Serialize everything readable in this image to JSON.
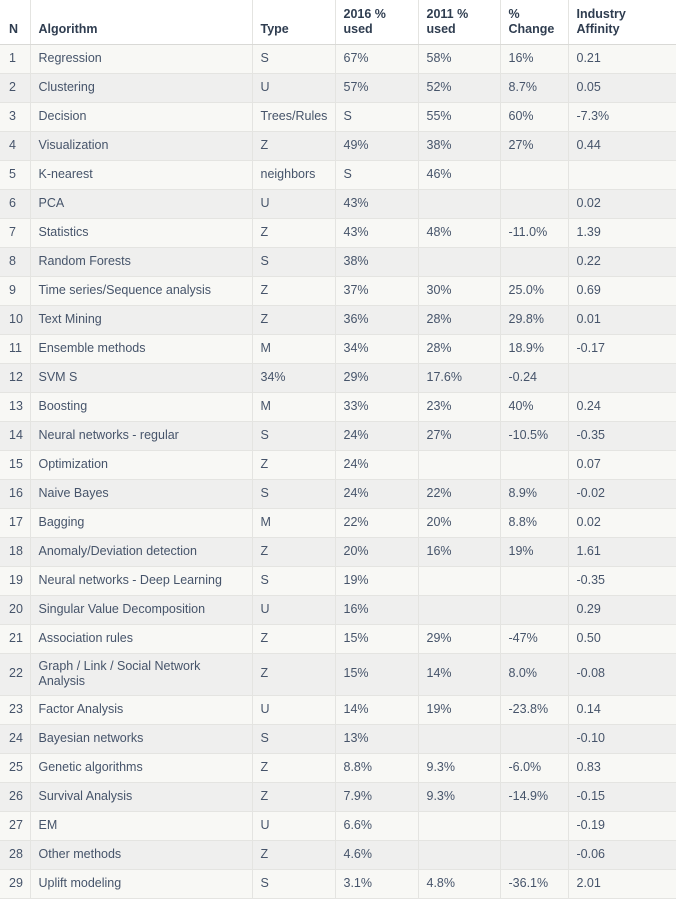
{
  "table": {
    "columns": [
      {
        "key": "n",
        "label": "N"
      },
      {
        "key": "alg",
        "label": "Algorithm"
      },
      {
        "key": "type",
        "label": "Type"
      },
      {
        "key": "y2016",
        "label": "2016 %\nused"
      },
      {
        "key": "y2011",
        "label": "2011 %\nused"
      },
      {
        "key": "change",
        "label": "%\nChange"
      },
      {
        "key": "aff",
        "label": "Industry\nAffinity"
      }
    ],
    "rows": [
      {
        "n": "1",
        "alg": "Regression",
        "type": "S",
        "y2016": "67%",
        "y2011": "58%",
        "change": "16%",
        "aff": "0.21"
      },
      {
        "n": "2",
        "alg": "Clustering",
        "type": "U",
        "y2016": "57%",
        "y2011": "52%",
        "change": "8.7%",
        "aff": "0.05"
      },
      {
        "n": "3",
        "alg": "Decision",
        "type": "Trees/Rules",
        "y2016": "S",
        "y2011": "55%",
        "change": "60%",
        "aff": "-7.3%"
      },
      {
        "n": "4",
        "alg": "Visualization",
        "type": "Z",
        "y2016": "49%",
        "y2011": "38%",
        "change": "27%",
        "aff": "0.44"
      },
      {
        "n": "5",
        "alg": "K-nearest",
        "type": "neighbors",
        "y2016": "S",
        "y2011": "46%",
        "change": "",
        "aff": ""
      },
      {
        "n": "6",
        "alg": "PCA",
        "type": "U",
        "y2016": "43%",
        "y2011": "",
        "change": "",
        "aff": "0.02"
      },
      {
        "n": "7",
        "alg": "Statistics",
        "type": "Z",
        "y2016": "43%",
        "y2011": "48%",
        "change": "-11.0%",
        "aff": "1.39"
      },
      {
        "n": "8",
        "alg": "Random Forests",
        "type": "S",
        "y2016": "38%",
        "y2011": "",
        "change": "",
        "aff": "0.22"
      },
      {
        "n": "9",
        "alg": "Time series/Sequence analysis",
        "type": "Z",
        "y2016": "37%",
        "y2011": "30%",
        "change": "25.0%",
        "aff": "0.69"
      },
      {
        "n": "10",
        "alg": "Text Mining",
        "type": "Z",
        "y2016": "36%",
        "y2011": "28%",
        "change": "29.8%",
        "aff": "0.01"
      },
      {
        "n": "11",
        "alg": "Ensemble methods",
        "type": "M",
        "y2016": "34%",
        "y2011": "28%",
        "change": "18.9%",
        "aff": "-0.17"
      },
      {
        "n": "12",
        "alg": "SVM S",
        "type": "34%",
        "y2016": "29%",
        "y2011": "17.6%",
        "change": "-0.24",
        "aff": ""
      },
      {
        "n": "13",
        "alg": "Boosting",
        "type": "M",
        "y2016": "33%",
        "y2011": "23%",
        "change": "40%",
        "aff": "0.24"
      },
      {
        "n": "14",
        "alg": "Neural networks - regular",
        "type": "S",
        "y2016": "24%",
        "y2011": "27%",
        "change": "-10.5%",
        "aff": "-0.35"
      },
      {
        "n": "15",
        "alg": "Optimization",
        "type": "Z",
        "y2016": "24%",
        "y2011": "",
        "change": "",
        "aff": "0.07"
      },
      {
        "n": "16",
        "alg": "Naive Bayes",
        "type": "S",
        "y2016": "24%",
        "y2011": "22%",
        "change": "8.9%",
        "aff": "-0.02"
      },
      {
        "n": "17",
        "alg": "Bagging",
        "type": "M",
        "y2016": "22%",
        "y2011": "20%",
        "change": "8.8%",
        "aff": "0.02"
      },
      {
        "n": "18",
        "alg": "Anomaly/Deviation detection",
        "type": "Z",
        "y2016": "20%",
        "y2011": "16%",
        "change": "19%",
        "aff": "1.61"
      },
      {
        "n": "19",
        "alg": "Neural networks - Deep Learning",
        "type": "S",
        "y2016": "19%",
        "y2011": "",
        "change": "",
        "aff": "-0.35"
      },
      {
        "n": "20",
        "alg": "Singular Value Decomposition",
        "type": "U",
        "y2016": "16%",
        "y2011": "",
        "change": "",
        "aff": "0.29"
      },
      {
        "n": "21",
        "alg": "Association rules",
        "type": "Z",
        "y2016": "15%",
        "y2011": "29%",
        "change": "-47%",
        "aff": "0.50"
      },
      {
        "n": "22",
        "alg": "Graph / Link / Social Network Analysis",
        "type": "Z",
        "y2016": "15%",
        "y2011": "14%",
        "change": "8.0%",
        "aff": "-0.08",
        "tall": true
      },
      {
        "n": "23",
        "alg": "Factor Analysis",
        "type": "U",
        "y2016": "14%",
        "y2011": "19%",
        "change": "-23.8%",
        "aff": "0.14"
      },
      {
        "n": "24",
        "alg": "Bayesian networks",
        "type": "S",
        "y2016": "13%",
        "y2011": "",
        "change": "",
        "aff": "-0.10"
      },
      {
        "n": "25",
        "alg": "Genetic algorithms",
        "type": "Z",
        "y2016": "8.8%",
        "y2011": "9.3%",
        "change": "-6.0%",
        "aff": "0.83"
      },
      {
        "n": "26",
        "alg": "Survival Analysis",
        "type": "Z",
        "y2016": "7.9%",
        "y2011": "9.3%",
        "change": "-14.9%",
        "aff": "-0.15"
      },
      {
        "n": "27",
        "alg": "EM",
        "type": "U",
        "y2016": "6.6%",
        "y2011": "",
        "change": "",
        "aff": "-0.19"
      },
      {
        "n": "28",
        "alg": "Other methods",
        "type": "Z",
        "y2016": "4.6%",
        "y2011": "",
        "change": "",
        "aff": "-0.06"
      },
      {
        "n": "29",
        "alg": "Uplift modeling",
        "type": "S",
        "y2016": "3.1%",
        "y2011": "4.8%",
        "change": "-36.1%",
        "aff": "2.01"
      }
    ]
  },
  "colors": {
    "text": "#46546a",
    "header_text": "#2f3d50",
    "row_odd": "#f8f8f5",
    "row_even": "#efefee",
    "border": "#e4e4e1",
    "page_bg": "#ffffff"
  }
}
